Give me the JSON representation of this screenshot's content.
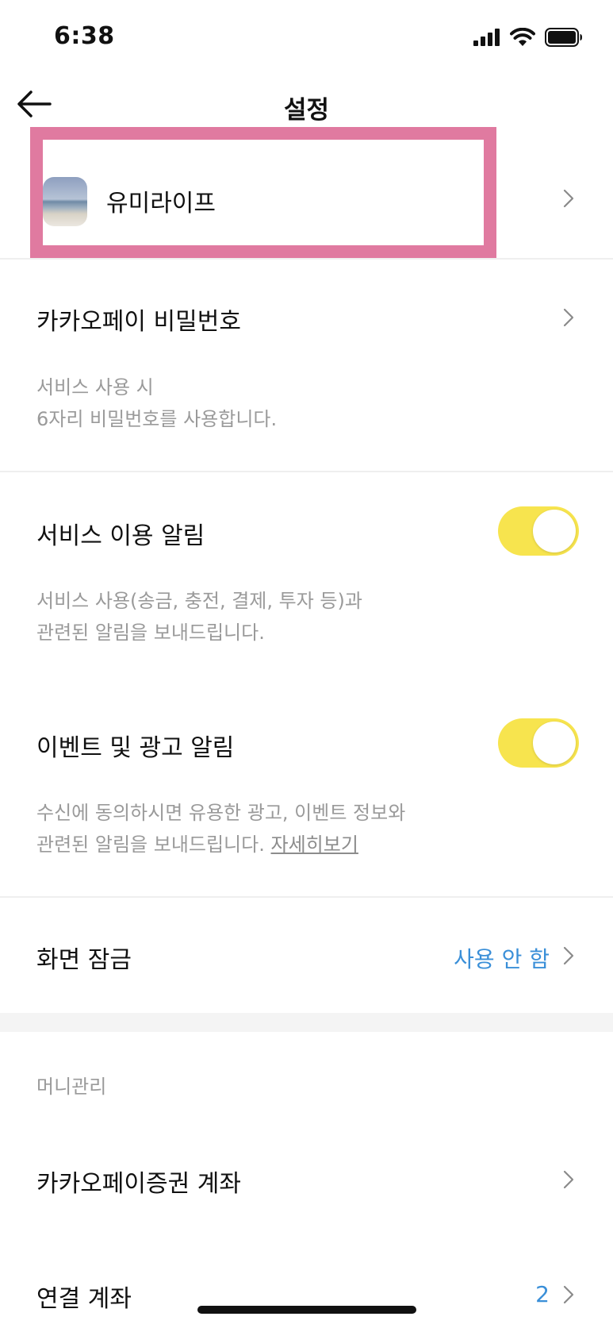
{
  "status_bar": {
    "time": "6:38",
    "icons": [
      "signal-icon",
      "wifi-icon",
      "battery-icon"
    ]
  },
  "header": {
    "title": "설정",
    "back_icon": "back-arrow-icon"
  },
  "profile": {
    "name": "유미라이프",
    "highlight_color": "#e07aa0"
  },
  "password": {
    "title": "카카오페이 비밀번호",
    "desc_line1": "서비스 사용 시",
    "desc_line2": "6자리 비밀번호를 사용합니다."
  },
  "service_alert": {
    "title": "서비스 이용 알림",
    "enabled": true,
    "desc_line1": "서비스 사용(송금, 충전, 결제, 투자 등)과",
    "desc_line2": "관련된 알림을 보내드립니다."
  },
  "event_alert": {
    "title": "이벤트 및 광고 알림",
    "enabled": true,
    "desc_line1": "수신에 동의하시면 유용한 광고, 이벤트 정보와",
    "desc_line2": "관련된 알림을 보내드립니다.",
    "detail_link": "자세히보기"
  },
  "screen_lock": {
    "title": "화면 잠금",
    "value": "사용 안 함"
  },
  "money_section": {
    "label": "머니관리",
    "securities_account": "카카오페이증권 계좌",
    "linked_account": {
      "title": "연결 계좌",
      "count": "2"
    }
  },
  "colors": {
    "toggle_on": "#f7e44e",
    "accent_blue": "#3a8fd8",
    "secondary_text": "#9a9a9a"
  }
}
